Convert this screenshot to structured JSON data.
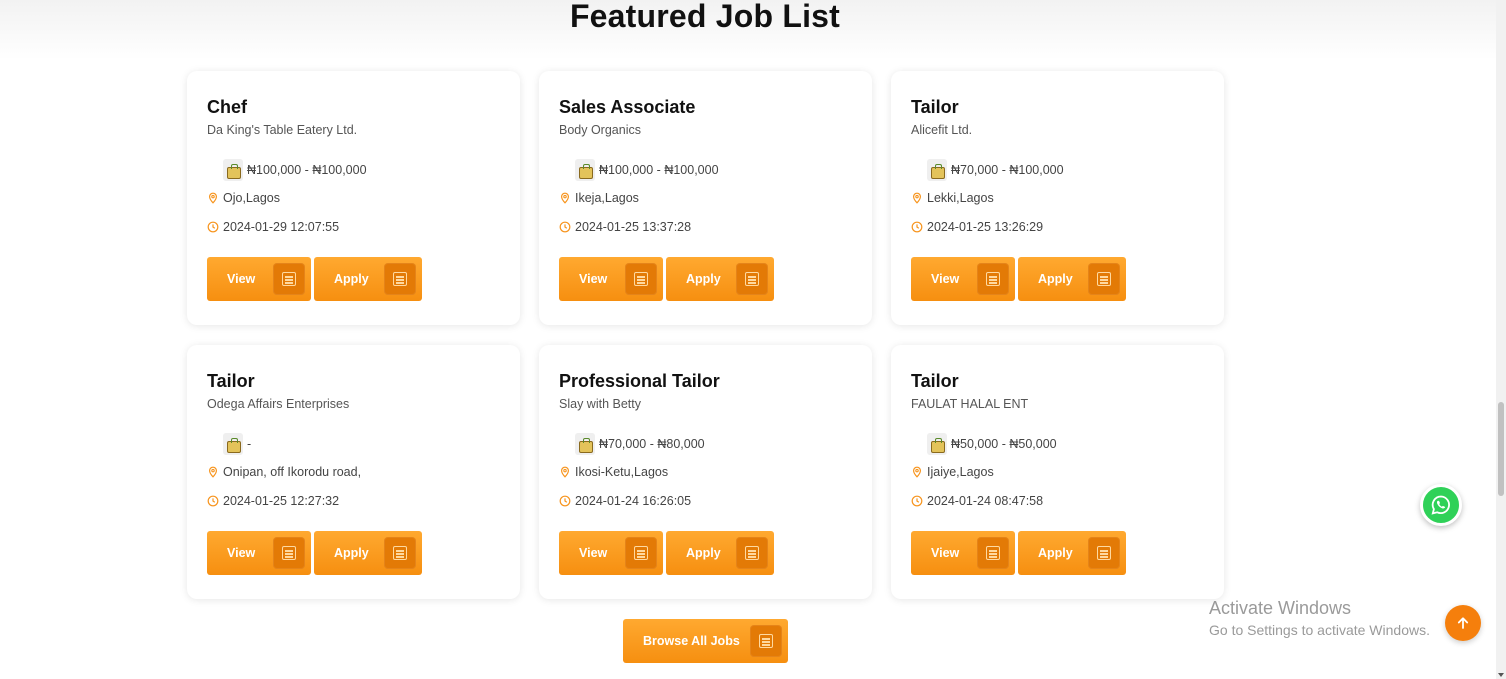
{
  "section": {
    "title": "Featured Job List"
  },
  "jobs": [
    {
      "title": "Chef",
      "company": "Da King's Table Eatery Ltd.",
      "salary": "₦100,000 - ₦100,000",
      "location": "Ojo,Lagos",
      "posted": "2024-01-29 12:07:55"
    },
    {
      "title": "Sales Associate",
      "company": "Body Organics",
      "salary": "₦100,000 - ₦100,000",
      "location": "Ikeja,Lagos",
      "posted": "2024-01-25 13:37:28"
    },
    {
      "title": "Tailor",
      "company": "Alicefit Ltd.",
      "salary": "₦70,000 - ₦100,000",
      "location": "Lekki,Lagos",
      "posted": "2024-01-25 13:26:29"
    },
    {
      "title": "Tailor",
      "company": "Odega Affairs Enterprises",
      "salary": "-",
      "location": "Onipan, off Ikorodu road,",
      "posted": "2024-01-25 12:27:32"
    },
    {
      "title": "Professional Tailor",
      "company": "Slay with Betty",
      "salary": "₦70,000 - ₦80,000",
      "location": "Ikosi-Ketu,Lagos",
      "posted": "2024-01-24 16:26:05"
    },
    {
      "title": "Tailor",
      "company": "FAULAT HALAL ENT",
      "salary": "₦50,000 - ₦50,000",
      "location": "Ijaiye,Lagos",
      "posted": "2024-01-24 08:47:58"
    }
  ],
  "buttons": {
    "view": "View",
    "apply": "Apply",
    "browse_all": "Browse All Jobs"
  },
  "watermark": {
    "title": "Activate Windows",
    "subtitle": "Go to Settings to activate Windows."
  },
  "icons": {
    "salary": "money-bag-icon",
    "location": "map-pin-icon",
    "date": "clock-icon",
    "button": "document-icon",
    "chat": "whatsapp-icon",
    "scroll": "arrow-up-icon"
  },
  "colors": {
    "accent": "#f7941d",
    "accent_dark": "#e37a06",
    "whatsapp": "#2fd158"
  }
}
